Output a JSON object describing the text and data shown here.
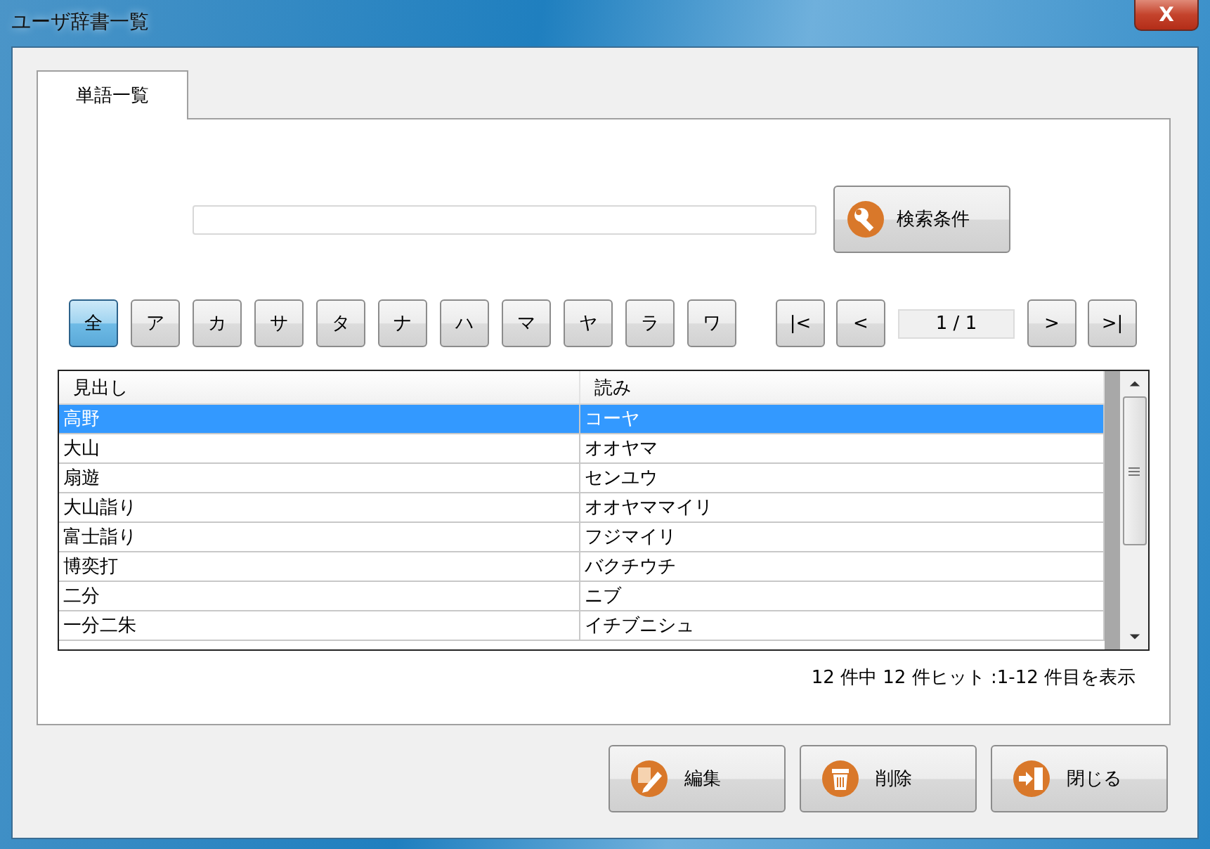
{
  "window": {
    "title": "ユーザ辞書一覧",
    "close": "X"
  },
  "tabs": [
    {
      "label": "単語一覧",
      "selected": true
    }
  ],
  "search": {
    "button": "検索条件"
  },
  "kana_buttons": [
    {
      "label": "全",
      "selected": true
    },
    {
      "label": "ア",
      "selected": false
    },
    {
      "label": "カ",
      "selected": false
    },
    {
      "label": "サ",
      "selected": false
    },
    {
      "label": "タ",
      "selected": false
    },
    {
      "label": "ナ",
      "selected": false
    },
    {
      "label": "ハ",
      "selected": false
    },
    {
      "label": "マ",
      "selected": false
    },
    {
      "label": "ヤ",
      "selected": false
    },
    {
      "label": "ラ",
      "selected": false
    },
    {
      "label": "ワ",
      "selected": false
    }
  ],
  "pager": {
    "first": "|<",
    "prev": "<",
    "page": "1 / 1",
    "next": ">",
    "last": ">|"
  },
  "table": {
    "columns": [
      "見出し",
      "読み"
    ],
    "rows": [
      {
        "heading": "高野",
        "reading": "コーヤ",
        "selected": true
      },
      {
        "heading": "大山",
        "reading": "オオヤマ",
        "selected": false
      },
      {
        "heading": "扇遊",
        "reading": "センユウ",
        "selected": false
      },
      {
        "heading": "大山詣り",
        "reading": "オオヤママイリ",
        "selected": false
      },
      {
        "heading": "富士詣り",
        "reading": "フジマイリ",
        "selected": false
      },
      {
        "heading": "博奕打",
        "reading": "バクチウチ",
        "selected": false
      },
      {
        "heading": "二分",
        "reading": "ニブ",
        "selected": false
      },
      {
        "heading": "一分二朱",
        "reading": "イチブニシュ",
        "selected": false
      }
    ]
  },
  "status": "12 件中 12 件ヒット :1-12 件目を表示",
  "buttons": [
    {
      "label": "編集",
      "kind": "edit"
    },
    {
      "label": "削除",
      "kind": "delete"
    },
    {
      "label": "閉じる",
      "kind": "close"
    }
  ]
}
